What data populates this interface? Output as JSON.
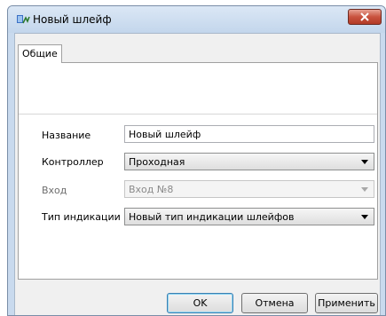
{
  "window": {
    "title": "Новый шлейф",
    "icon": "app-icon"
  },
  "tabs": [
    {
      "label": "Общие",
      "selected": true
    }
  ],
  "form": {
    "name": {
      "label": "Название",
      "value": "Новый шлейф"
    },
    "controller": {
      "label": "Контроллер",
      "value": "Проходная"
    },
    "input": {
      "label": "Вход",
      "value": "Вход №8",
      "enabled": false
    },
    "indication": {
      "label": "Тип индикации",
      "value": "Новый тип индикации шлейфов"
    }
  },
  "buttons": {
    "ok": "OK",
    "cancel": "Отмена",
    "apply": "Применить"
  },
  "colors": {
    "close_button": "#c9533f",
    "window_frame": "#c9daee",
    "default_button_border": "#3c7fb1"
  }
}
